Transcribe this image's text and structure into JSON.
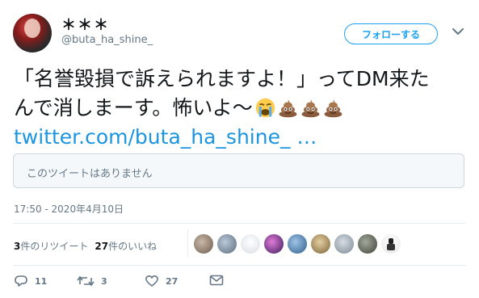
{
  "user": {
    "display_name": "＊＊＊",
    "handle": "@buta_ha_shine_"
  },
  "follow_button": {
    "label": "フォローする"
  },
  "tweet": {
    "line1": "「名誉毀損で訴えられますよ！」ってDM来た",
    "line2": "んで消しまーす。怖いよ〜",
    "link": "twitter.com/buta_ha_shine_ …",
    "emoji": [
      "loudly-crying-face-emoji",
      "poop-emoji",
      "poop-emoji",
      "poop-emoji"
    ]
  },
  "quoted": {
    "text": "このツイートはありません"
  },
  "timestamp": "17:50 - 2020年4月10日",
  "stats": {
    "retweets_count": "3",
    "retweets_label": "件のリツイート",
    "likes_count": "27",
    "likes_label": "件のいいね"
  },
  "actions": {
    "replies": "11",
    "retweets": "3",
    "likes": "27"
  },
  "colors": {
    "link": "#1b95e0",
    "accent": "#1da1f2",
    "muted": "#657786"
  }
}
